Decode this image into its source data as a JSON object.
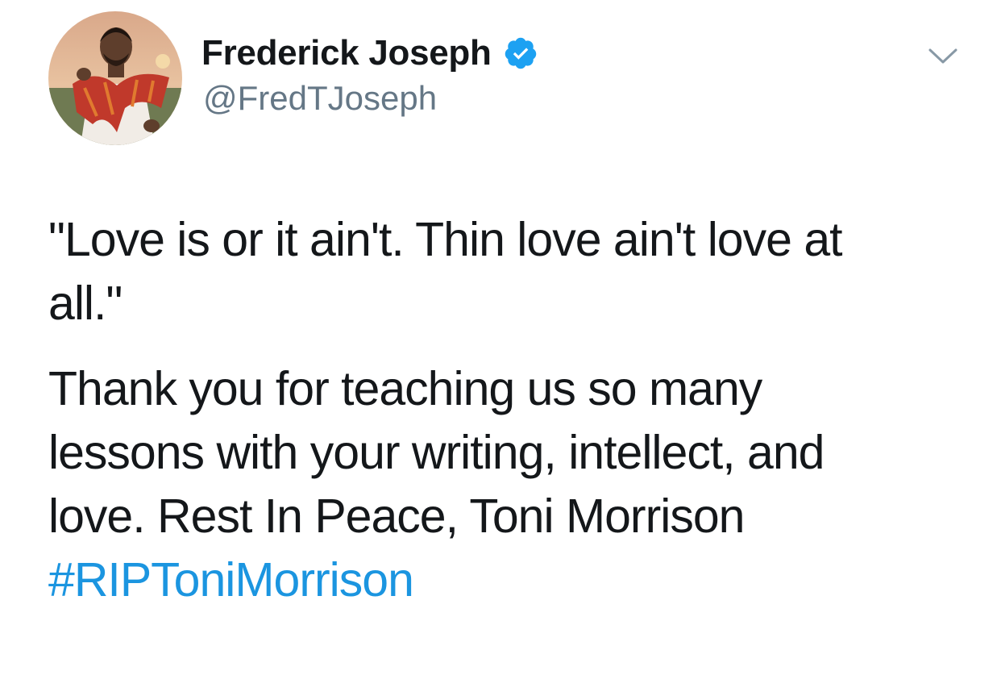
{
  "author": {
    "display_name": "Frederick Joseph",
    "handle": "@FredTJoseph",
    "verified": true,
    "avatar_icon": "profile-photo"
  },
  "tweet": {
    "paragraph_1_line_1": "\"Love is or it ain't. Thin love ain't love at",
    "paragraph_1_line_2": "all.\"",
    "paragraph_2_line_1": "Thank you for teaching us so many",
    "paragraph_2_line_2": "lessons with your writing, intellect, and",
    "paragraph_2_line_3": "love. Rest In Peace, Toni Morrison",
    "hashtag": "#RIPToniMorrison"
  },
  "menu": {
    "icon": "chevron-down-icon"
  },
  "colors": {
    "text": "#14171a",
    "secondary": "#657786",
    "link": "#1b95e0",
    "verified": "#1da1f2"
  }
}
